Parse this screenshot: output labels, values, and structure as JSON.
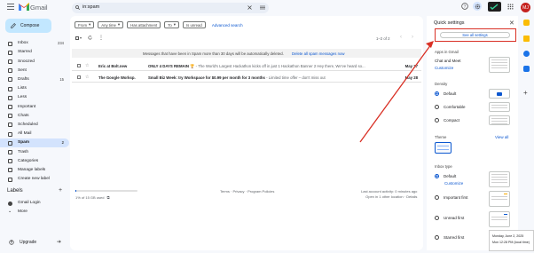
{
  "app": {
    "name": "Gmail",
    "avatar_initials": "MJ"
  },
  "search": {
    "value": "in:spam"
  },
  "compose": {
    "label": "Compose"
  },
  "sidebar": {
    "items": [
      {
        "label": "Inbox",
        "count": "234",
        "icon": "inbox-icon"
      },
      {
        "label": "Starred",
        "count": "",
        "icon": "star-icon"
      },
      {
        "label": "Snoozed",
        "count": "",
        "icon": "clock-icon"
      },
      {
        "label": "Sent",
        "count": "",
        "icon": "send-icon"
      },
      {
        "label": "Drafts",
        "count": "15",
        "icon": "draft-icon"
      },
      {
        "label": "Lists",
        "count": "",
        "icon": "list-icon"
      },
      {
        "label": "Less",
        "count": "",
        "icon": "chevron-up-icon"
      },
      {
        "label": "Important",
        "count": "",
        "icon": "important-icon"
      },
      {
        "label": "Chats",
        "count": "",
        "icon": "chat-icon"
      },
      {
        "label": "Scheduled",
        "count": "",
        "icon": "schedule-icon"
      },
      {
        "label": "All Mail",
        "count": "",
        "icon": "mail-icon"
      },
      {
        "label": "Spam",
        "count": "2",
        "icon": "spam-icon"
      },
      {
        "label": "Trash",
        "count": "",
        "icon": "trash-icon"
      },
      {
        "label": "Categories",
        "count": "",
        "icon": "label-icon"
      },
      {
        "label": "Manage labels",
        "count": "",
        "icon": "gear-icon"
      },
      {
        "label": "Create new label",
        "count": "",
        "icon": "plus-icon"
      }
    ],
    "labels_header": "Labels",
    "labels": [
      {
        "label": "Gmail Login"
      },
      {
        "label": "More"
      }
    ],
    "upgrade": "Upgrade"
  },
  "filters": {
    "chips": [
      "From",
      "Any time",
      "Has attachment",
      "To",
      "Is unread"
    ],
    "advanced": "Advanced search"
  },
  "pagination": "1–2 of 2",
  "spam_banner": {
    "text": "Messages that have been in Spam more than 30 days will be automatically deleted.",
    "action": "Delete all spam messages now"
  },
  "emails": [
    {
      "from": "Eric at Bolt.new",
      "subject": "ONLY 4 DAYS REMAIN 🏆",
      "snippet": " - The World's Largest Hackathon kicks off in just 1 Hackathon Banner 2 Hey there, We've heard so...",
      "date": "May 27"
    },
    {
      "from": "The Google Worksp.",
      "subject": "Small Biz Week: try Workspace for $0.99 per month for 3 months",
      "snippet": " - Limited time offer – don't miss out",
      "date": "May 28"
    }
  ],
  "footer": {
    "storage": "1% of 15 GB used",
    "links": "Terms · Privacy · Program Policies",
    "activity": "Last account activity: 0 minutes ago",
    "details": "Open in 1 other location · Details"
  },
  "quick_settings": {
    "title": "Quick settings",
    "see_all": "See all settings",
    "apps_header": "Apps in Gmail",
    "apps_text": "Chat and Meet",
    "customize": "Customize",
    "density_header": "Density",
    "density": [
      "Default",
      "Comfortable",
      "Compact"
    ],
    "theme_header": "Theme",
    "view_all": "View all",
    "inbox_type_header": "Inbox type",
    "inbox_types": [
      "Default",
      "Important first",
      "Unread first",
      "Starred first"
    ]
  },
  "tooltip": {
    "line1": "Monday, June 2, 2025",
    "line2": "Mon 12:28 PM (local time)"
  },
  "colors": {
    "accent": "#0b57d0",
    "highlight_red": "#d93025",
    "spam_active_bg": "#d3e3fd"
  }
}
